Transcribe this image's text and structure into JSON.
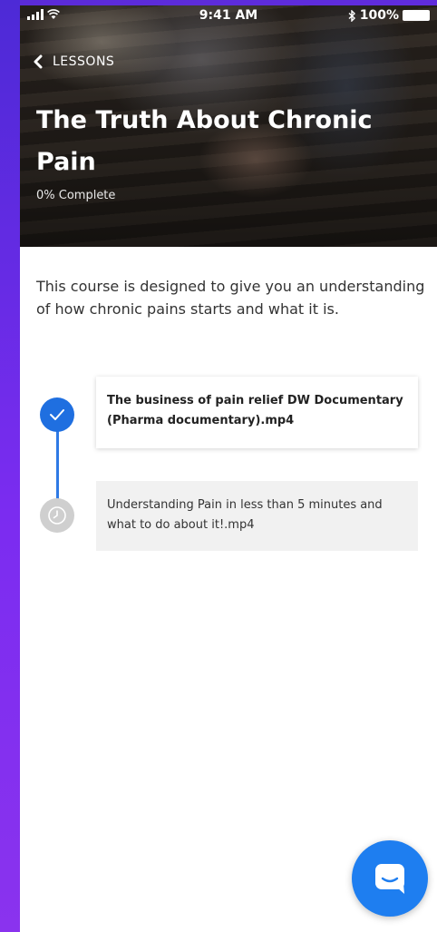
{
  "status_bar": {
    "time": "9:41 AM",
    "battery": "100%"
  },
  "header": {
    "back_label": "LESSONS",
    "title": "The Truth About Chronic Pain",
    "progress_text": "0% Complete"
  },
  "course": {
    "description": "This course is designed to give you an understanding of how chronic pains starts and what it is."
  },
  "lessons": [
    {
      "title": "The business of pain relief DW Documentary (Pharma documentary).mp4",
      "status": "completed"
    },
    {
      "title": "Understanding Pain in less than 5 minutes and what to do about it!.mp4",
      "status": "pending"
    }
  ],
  "colors": {
    "accent": "#1f6fe0",
    "pending": "#cfcfcf",
    "fab": "#1e7ef0"
  },
  "icons": {
    "back": "chevron-left-icon",
    "completed": "check-icon",
    "pending": "clock-icon",
    "chat": "chat-bubble-icon"
  }
}
